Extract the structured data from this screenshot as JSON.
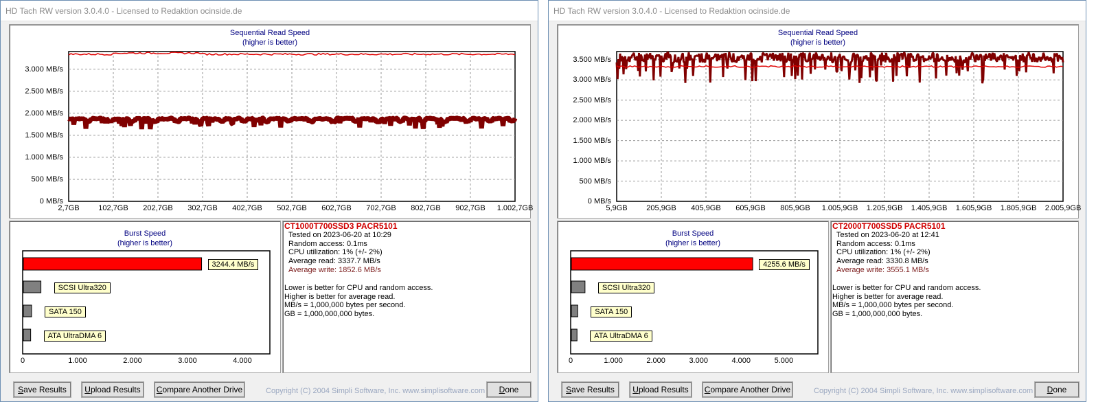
{
  "windows": [
    {
      "title": "HD Tach RW version 3.0.4.0 - Licensed to Redaktion ocinside.de",
      "seq": {
        "title": "Sequential Read Speed",
        "subtitle": "(higher is better)",
        "y_ticks": [
          "3.000 MB/s",
          "2.500 MB/s",
          "2.000 MB/s",
          "1.500 MB/s",
          "1.000 MB/s",
          "500 MB/s",
          "0 MB/s"
        ],
        "y_values": [
          3000,
          2500,
          2000,
          1500,
          1000,
          500,
          0
        ],
        "y_max": 3400,
        "x_ticks": [
          "2,7GB",
          "102,7GB",
          "202,7GB",
          "302,7GB",
          "402,7GB",
          "502,7GB",
          "602,7GB",
          "702,7GB",
          "802,7GB",
          "902,7GB",
          "1.002,7GB"
        ],
        "read_level": 3340,
        "write_level": 1852,
        "write_pattern": "blocky"
      },
      "burst": {
        "title": "Burst Speed",
        "subtitle": "(higher is better)",
        "value_label": "3244.4 MB/s",
        "value": 3244.4,
        "axis_max": 4500,
        "axis_ticks": [
          "0",
          "1.000",
          "2.000",
          "3.000",
          "4.000"
        ],
        "axis_values": [
          0,
          1000,
          2000,
          3000,
          4000
        ],
        "refs": [
          {
            "label": "SCSI Ultra320",
            "value": 320
          },
          {
            "label": "SATA 150",
            "value": 150
          },
          {
            "label": "ATA UltraDMA 6",
            "value": 133
          }
        ]
      },
      "info": {
        "model": "CT1000T700SSD3 PACR5101",
        "tested": "Tested on 2023-06-20 at 10:29",
        "random": "Random access: 0.1ms",
        "cpu": "CPU utilization: 1% (+/- 2%)",
        "avg_read": "Average read: 3337.7 MB/s",
        "avg_write": "Average write: 1852.6 MB/s",
        "notes": [
          "Lower is better for CPU and random access.",
          "Higher is better for average read.",
          "MB/s = 1,000,000 bytes per second.",
          "GB = 1,000,000,000 bytes."
        ]
      },
      "buttons": {
        "save_prefix": "S",
        "save_rest": "ave Results",
        "upload_prefix": "U",
        "upload_rest": "pload Results",
        "compare_prefix": "C",
        "compare_rest": "ompare Another Drive",
        "done_prefix": "D",
        "done_rest": "one"
      },
      "copyright": "Copyright (C) 2004 Simpli Software, Inc. www.simplisoftware.com"
    },
    {
      "title": "HD Tach RW version 3.0.4.0 - Licensed to Redaktion ocinside.de",
      "seq": {
        "title": "Sequential Read Speed",
        "subtitle": "(higher is better)",
        "y_ticks": [
          "3.500 MB/s",
          "3.000 MB/s",
          "2.500 MB/s",
          "2.000 MB/s",
          "1.500 MB/s",
          "1.000 MB/s",
          "500 MB/s",
          "0 MB/s"
        ],
        "y_values": [
          3500,
          3000,
          2500,
          2000,
          1500,
          1000,
          500,
          0
        ],
        "y_max": 3700,
        "x_ticks": [
          "5,9GB",
          "205,9GB",
          "405,9GB",
          "605,9GB",
          "805,9GB",
          "1.005,9GB",
          "1.205,9GB",
          "1.405,9GB",
          "1.605,9GB",
          "1.805,9GB",
          "2.005,9GB"
        ],
        "read_level": 3330,
        "write_level": 3555,
        "write_pattern": "noisy"
      },
      "burst": {
        "title": "Burst Speed",
        "subtitle": "(higher is better)",
        "value_label": "4255.6 MB/s",
        "value": 4255.6,
        "axis_max": 5800,
        "axis_ticks": [
          "0",
          "1.000",
          "2.000",
          "3.000",
          "4.000",
          "5.000"
        ],
        "axis_values": [
          0,
          1000,
          2000,
          3000,
          4000,
          5000
        ],
        "refs": [
          {
            "label": "SCSI Ultra320",
            "value": 320
          },
          {
            "label": "SATA 150",
            "value": 150
          },
          {
            "label": "ATA UltraDMA 6",
            "value": 133
          }
        ]
      },
      "info": {
        "model": "CT2000T700SSD5 PACR5101",
        "tested": "Tested on 2023-06-20 at 12:41",
        "random": "Random access: 0.1ms",
        "cpu": "CPU utilization: 1% (+/- 2%)",
        "avg_read": "Average read: 3330.8 MB/s",
        "avg_write": "Average write: 3555.1 MB/s",
        "notes": [
          "Lower is better for CPU and random access.",
          "Higher is better for average read.",
          "MB/s = 1,000,000 bytes per second.",
          "GB = 1,000,000,000 bytes."
        ]
      },
      "buttons": {
        "save_prefix": "S",
        "save_rest": "ave Results",
        "upload_prefix": "U",
        "upload_rest": "pload Results",
        "compare_prefix": "C",
        "compare_rest": "ompare Another Drive",
        "done_prefix": "D",
        "done_rest": "one"
      },
      "copyright": "Copyright (C) 2004 Simpli Software, Inc. www.simplisoftware.com"
    }
  ],
  "colors": {
    "read_line": "#e00000",
    "write_line": "#800000",
    "burst_bar": "#ff0000",
    "ref_bar": "#808080",
    "title_blue": "#000080"
  }
}
